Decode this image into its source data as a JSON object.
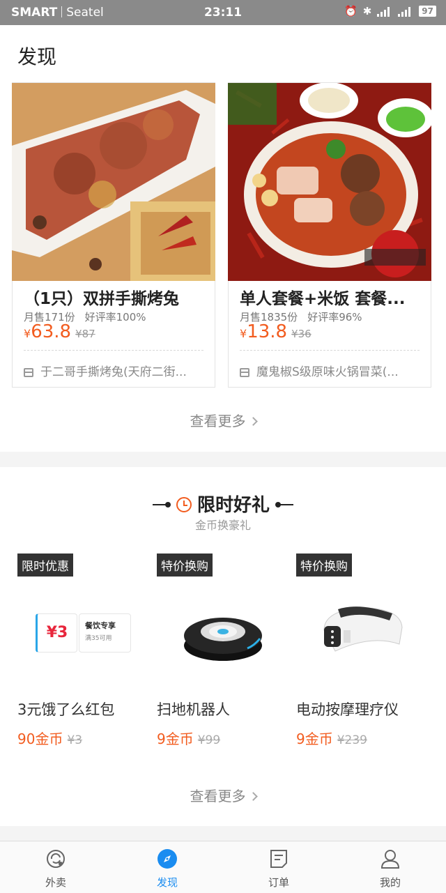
{
  "status_bar": {
    "carrier": "SMART",
    "network": "Seatel",
    "time": "23:11",
    "battery": "97"
  },
  "discover": {
    "title": "发现",
    "cards": [
      {
        "name": "（1只）双拼手撕烤兔",
        "monthly_sales": "月售171份",
        "rating": "好评率100%",
        "currency": "¥",
        "price": "63.8",
        "original_price": "¥87",
        "shop": "于二哥手撕烤兔(天府二街..."
      },
      {
        "name": "单人套餐+米饭 套餐...",
        "monthly_sales": "月售1835份",
        "rating": "好评率96%",
        "currency": "¥",
        "price": "13.8",
        "original_price": "¥36",
        "shop": "魔鬼椒S级原味火锅冒菜(..."
      }
    ],
    "see_more": "查看更多"
  },
  "gifts": {
    "title": "限时好礼",
    "subtitle": "金币换豪礼",
    "items": [
      {
        "tag": "限时优惠",
        "name": "3元饿了么红包",
        "coins": "90金币",
        "original": "¥3",
        "coupon_amount": "¥3",
        "coupon_title": "餐饮专享",
        "coupon_condition": "满35可用"
      },
      {
        "tag": "特价换购",
        "name": "扫地机器人",
        "coins": "9金币",
        "original": "¥99"
      },
      {
        "tag": "特价换购",
        "name": "电动按摩理疗仪",
        "coins": "9金币",
        "original": "¥239"
      }
    ],
    "see_more": "查看更多"
  },
  "tabbar": {
    "tabs": [
      {
        "label": "外卖",
        "icon": "takeout-icon",
        "active": false
      },
      {
        "label": "发现",
        "icon": "compass-icon",
        "active": true
      },
      {
        "label": "订单",
        "icon": "order-icon",
        "active": false
      },
      {
        "label": "我的",
        "icon": "profile-icon",
        "active": false
      }
    ]
  },
  "colors": {
    "accent": "#f25c1f",
    "active_tab": "#1a8cf0"
  }
}
